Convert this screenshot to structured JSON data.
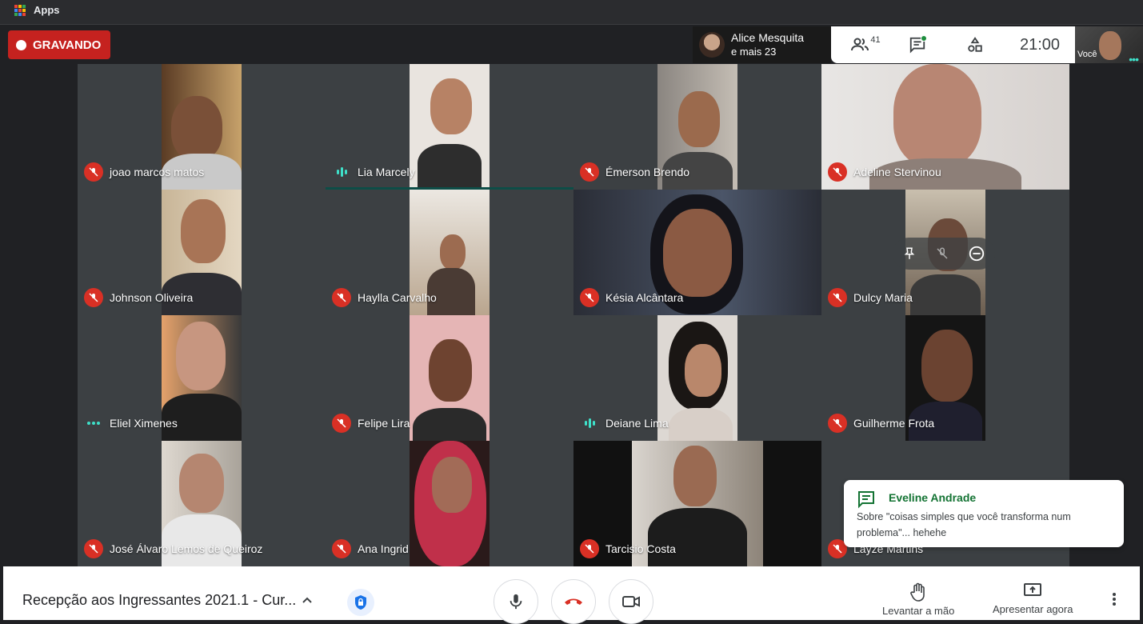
{
  "browser": {
    "apps_label": "Apps"
  },
  "recording": {
    "label": "GRAVANDO"
  },
  "presenter": {
    "name": "Alice Mesquita",
    "more": "e mais 23"
  },
  "top_panel": {
    "people_count": "41",
    "time": "21:00"
  },
  "self_view": {
    "label": "Você"
  },
  "participants": [
    {
      "name": "joao marcos matos",
      "status": "muted"
    },
    {
      "name": "Lia Marcely",
      "status": "speaking"
    },
    {
      "name": "Émerson Brendo",
      "status": "muted"
    },
    {
      "name": "Adeline Stervinou",
      "status": "muted"
    },
    {
      "name": "Johnson Oliveira",
      "status": "muted"
    },
    {
      "name": "Haylla Carvalho",
      "status": "muted"
    },
    {
      "name": "Késia Alcântara",
      "status": "muted"
    },
    {
      "name": "Dulcy Maria",
      "status": "muted"
    },
    {
      "name": "Eliel Ximenes",
      "status": "dots"
    },
    {
      "name": "Felipe Lira",
      "status": "muted"
    },
    {
      "name": "Deiane Lima",
      "status": "speaking"
    },
    {
      "name": "Guilherme Frota",
      "status": "muted"
    },
    {
      "name": "José Álvaro Lemos de Queiroz",
      "status": "muted"
    },
    {
      "name": "Ana Ingrid",
      "status": "muted"
    },
    {
      "name": "Tarcisio Costa",
      "status": "muted"
    },
    {
      "name": "Layze Martins",
      "status": "muted"
    }
  ],
  "toast": {
    "sender": "Eveline Andrade",
    "message": "Sobre \"coisas simples que você transforma num problema\"... hehehe"
  },
  "bottom_bar": {
    "meeting_title": "Recepção aos Ingressantes 2021.1 - Cur...",
    "raise_hand": "Levantar a mão",
    "present_now": "Apresentar agora"
  },
  "colors": {
    "recording": "#c5221f",
    "muted": "#d93025",
    "speaking": "#3ee0c9",
    "chat_sender": "#137333"
  }
}
